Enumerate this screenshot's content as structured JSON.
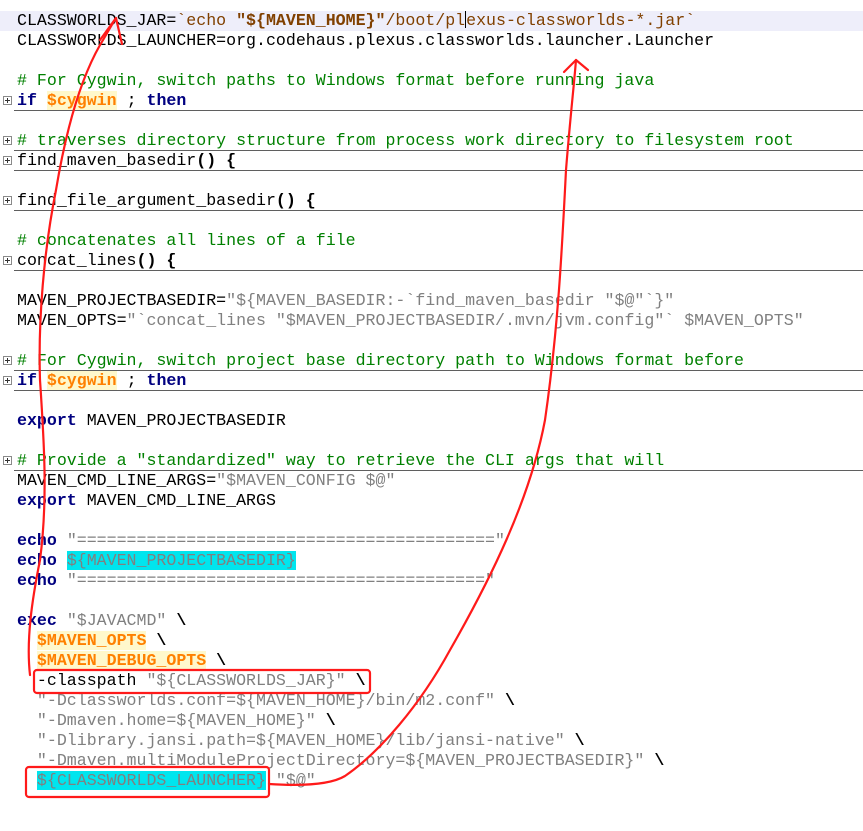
{
  "editor": {
    "lines": {
      "l1": {
        "a": "CLASSWORLDS_JAR=",
        "b": "`echo ",
        "c": "\"${MAVEN_HOME}\"",
        "d": "/boot/pl",
        "e": "exus-classworlds-*.jar`"
      },
      "l2": "CLASSWORLDS_LAUNCHER=org.codehaus.plexus.classworlds.launcher.Launcher",
      "l4": "# For Cygwin, switch paths to Windows format before running java",
      "l5": {
        "kw1": "if",
        "var": "$cygwin",
        "mid": " ; ",
        "kw2": "then"
      },
      "l7": "# traverses directory structure from process work directory to filesystem root",
      "l8": {
        "name": "find_maven_basedir",
        "parens": "()",
        "brace": " {"
      },
      "l10": {
        "name": "find_file_argument_basedir",
        "parens": "()",
        "brace": " {"
      },
      "l12": "# concatenates all lines of a file",
      "l13": {
        "name": "concat_lines",
        "parens": "()",
        "brace": " {"
      },
      "l15": {
        "a": "MAVEN_PROJECTBASEDIR=",
        "b": "\"${MAVEN_BASEDIR:-`find_maven_basedir \"$@\"`}\""
      },
      "l16": {
        "a": "MAVEN_OPTS=",
        "b": "\"`concat_lines \"$MAVEN_PROJECTBASEDIR/.mvn/jvm.config\"` $MAVEN_OPTS\""
      },
      "l18": "# For Cygwin, switch project base directory path to Windows format before",
      "l19": {
        "kw1": "if",
        "var": "$cygwin",
        "mid": " ; ",
        "kw2": "then"
      },
      "l21": {
        "kw": "export",
        "rest": " MAVEN_PROJECTBASEDIR"
      },
      "l23": "# Provide a \"standardized\" way to retrieve the CLI args that will",
      "l24": {
        "a": "MAVEN_CMD_LINE_ARGS=",
        "b": "\"$MAVEN_CONFIG $@\""
      },
      "l25": {
        "kw": "export",
        "rest": " MAVEN_CMD_LINE_ARGS"
      },
      "l27": {
        "kw": "echo",
        "sp": " ",
        "str": "\"==========================================\""
      },
      "l28": {
        "kw": "echo",
        "sp": " ",
        "hl": "${MAVEN_PROJECTBASEDIR}"
      },
      "l29": {
        "kw": "echo",
        "sp": " ",
        "str": "\"=========================================\""
      },
      "l31": {
        "kw": "exec",
        "sp": " ",
        "str": "\"$JAVACMD\"",
        "bs": " \\"
      },
      "l32": {
        "ind": "  ",
        "var": "$MAVEN_OPTS",
        "bs": " \\"
      },
      "l33": {
        "ind": "  ",
        "var": "$MAVEN_DEBUG_OPTS",
        "bs": " \\"
      },
      "l34": {
        "ind": "  ",
        "a": "-classpath ",
        "str": "\"${CLASSWORLDS_JAR}\"",
        "bs": " \\"
      },
      "l35": {
        "ind": "  ",
        "str": "\"-Dclassworlds.conf=${MAVEN_HOME}/bin/m2.conf\"",
        "bs": " \\"
      },
      "l36": {
        "ind": "  ",
        "str": "\"-Dmaven.home=${MAVEN_HOME}\"",
        "bs": " \\"
      },
      "l37": {
        "ind": "  ",
        "str": "\"-Dlibrary.jansi.path=${MAVEN_HOME}/lib/jansi-native\"",
        "bs": " \\"
      },
      "l38": {
        "ind": "  ",
        "str": "\"-Dmaven.multiModuleProjectDirectory=${MAVEN_PROJECTBASEDIR}\"",
        "bs": " \\"
      },
      "l39": {
        "ind": "  ",
        "hl": "${CLASSWORLDS_LAUNCHER}",
        "sp": " ",
        "str": "\"$@\""
      }
    }
  },
  "annotations": {
    "color": "#ff1a1a"
  }
}
